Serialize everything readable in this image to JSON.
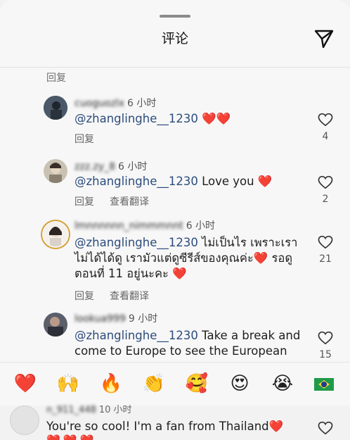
{
  "header": {
    "title": "评论"
  },
  "reply_top": "回复",
  "comments": [
    {
      "username": "cuoguozlx",
      "time": "6 小时",
      "mention": "@zhanglinghe__1230",
      "text": "❤️❤️",
      "actions": [
        "回复"
      ],
      "likes": "4"
    },
    {
      "username": "zzz.zy_8",
      "time": "6 小时",
      "mention": "@zhanglinghe__1230",
      "text": "Love you ❤️",
      "actions": [
        "回复",
        "查看翻译"
      ],
      "likes": "2"
    },
    {
      "username": "lmnnnnnn_nimmmnnt",
      "time": "6 小时",
      "mention": "@zhanglinghe__1230",
      "text": "ไม่เป็นไร เพราะเราไม่ได้ได้ดู เรามัวแต่ดูซีรีส์ของคุณค่ะ❤️ รอดูตอนที่ 11 อยู่นะคะ ❤️",
      "actions": [
        "回复",
        "查看翻译"
      ],
      "likes": "21"
    },
    {
      "username": "lookua999",
      "time": "9 小时",
      "mention": "@zhanglinghe__1230",
      "text": "Take a break and come to Europe to see the European",
      "actions": [],
      "likes": "15"
    }
  ],
  "emoji_bar": [
    "❤️",
    "🙌",
    "🔥",
    "👏",
    "🥰",
    "😍",
    "😭",
    "🇧🇷"
  ],
  "bottom_comment": {
    "username": "n_911_448",
    "time": "10 小时",
    "text": "You're so cool! I'm a fan from Thailand❤️",
    "hearts": "❤️❤️❤️"
  },
  "colors": {
    "accent_heart": "#e1302f",
    "mention": "#2c4c7d"
  },
  "icons": [
    "share-paper-plane-icon",
    "heart-outline-icon"
  ]
}
